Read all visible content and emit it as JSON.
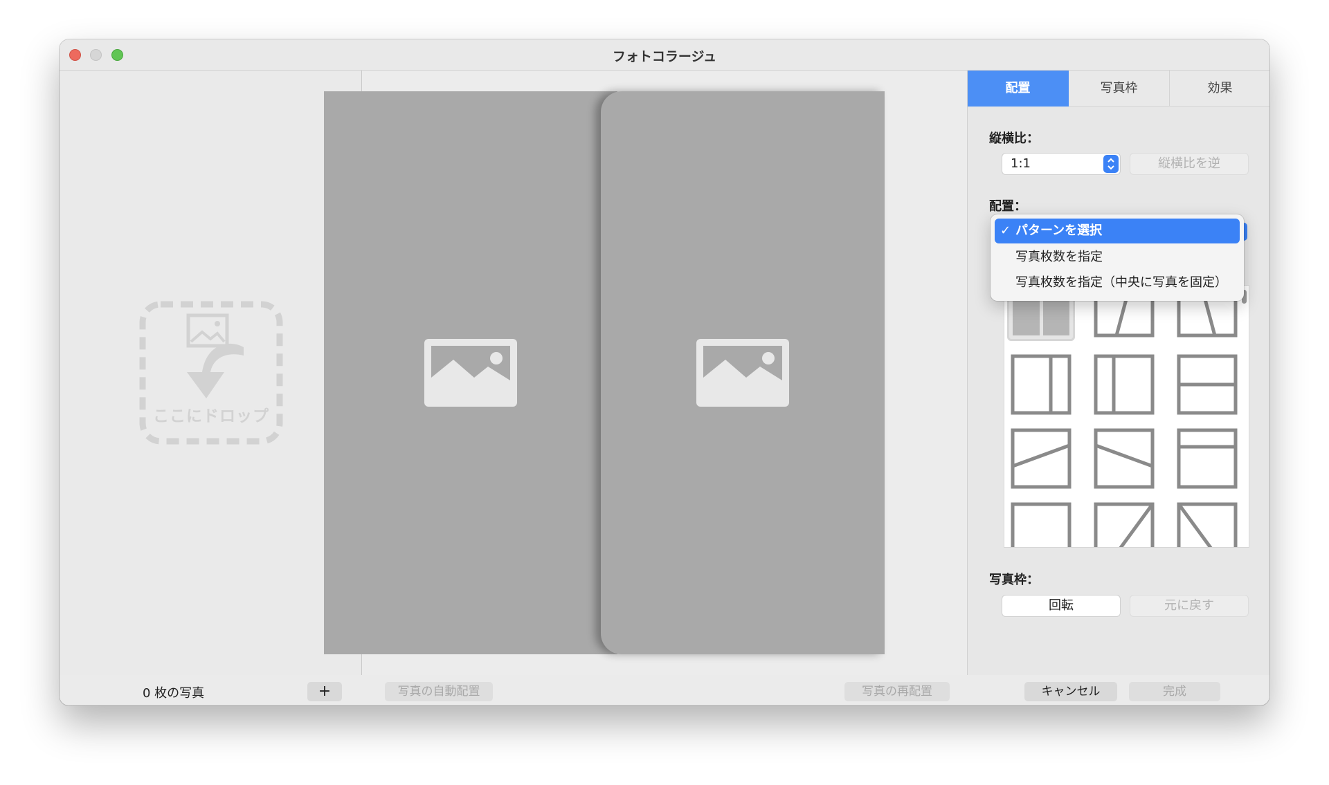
{
  "window": {
    "title": "フォトコラージュ"
  },
  "left_panel": {
    "drop_label": "ここにドロップ",
    "photo_count": "0 枚の写真",
    "add_label": "+"
  },
  "tabs": [
    {
      "label": "配置",
      "active": true
    },
    {
      "label": "写真枠",
      "active": false
    },
    {
      "label": "効果",
      "active": false
    }
  ],
  "aspect": {
    "label": "縦横比：",
    "value": "1:1",
    "reverse_label": "縦横比を逆"
  },
  "layout": {
    "label": "配置：",
    "options": [
      {
        "label": "パターンを選択",
        "selected": true
      },
      {
        "label": "写真枚数を指定",
        "selected": false
      },
      {
        "label": "写真枚数を指定（中央に写真を固定）",
        "selected": false
      }
    ]
  },
  "frame": {
    "label": "写真枠：",
    "rotate_label": "回転",
    "reset_label": "元に戻す"
  },
  "bottom": {
    "auto_arrange": "写真の自動配置",
    "rearrange": "写真の再配置",
    "cancel": "キャンセル",
    "done": "完成"
  },
  "colors": {
    "accent": "#4c8ff5",
    "photo_placeholder": "#a9a9a9"
  }
}
